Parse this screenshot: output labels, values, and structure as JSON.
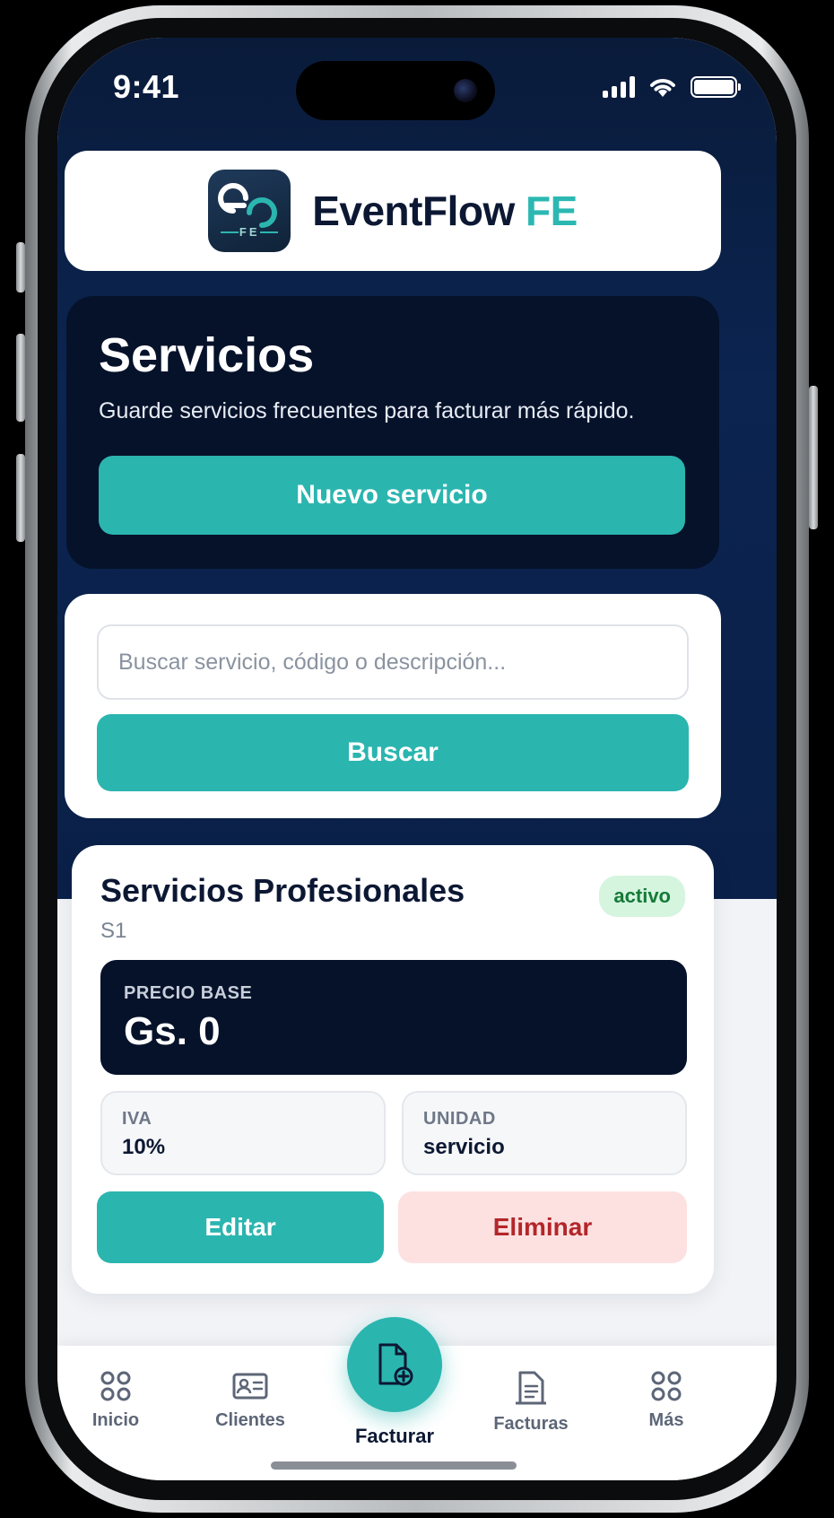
{
  "status_bar": {
    "time": "9:41"
  },
  "brand": {
    "name_main": "EventFlow",
    "name_accent": "FE",
    "logo_text": "FE",
    "accent_color": "#2bb5af",
    "dark_color": "#06122a"
  },
  "hero": {
    "title": "Servicios",
    "subtitle": "Guarde servicios frecuentes para facturar más rápido.",
    "new_service_label": "Nuevo servicio"
  },
  "search": {
    "placeholder": "Buscar servicio, código o descripción...",
    "button_label": "Buscar"
  },
  "service": {
    "name": "Servicios Profesionales",
    "code": "S1",
    "status": "activo",
    "price_label": "PRECIO BASE",
    "price_value": "Gs. 0",
    "iva_label": "IVA",
    "iva_value": "10%",
    "unit_label": "UNIDAD",
    "unit_value": "servicio",
    "edit_label": "Editar",
    "delete_label": "Eliminar"
  },
  "nav": {
    "items": [
      {
        "label": "Inicio",
        "icon": "grid-icon"
      },
      {
        "label": "Clientes",
        "icon": "id-card-icon"
      },
      {
        "label": "Facturar",
        "icon": "document-add-icon"
      },
      {
        "label": "Facturas",
        "icon": "document-icon"
      },
      {
        "label": "Más",
        "icon": "grid-icon"
      }
    ]
  }
}
